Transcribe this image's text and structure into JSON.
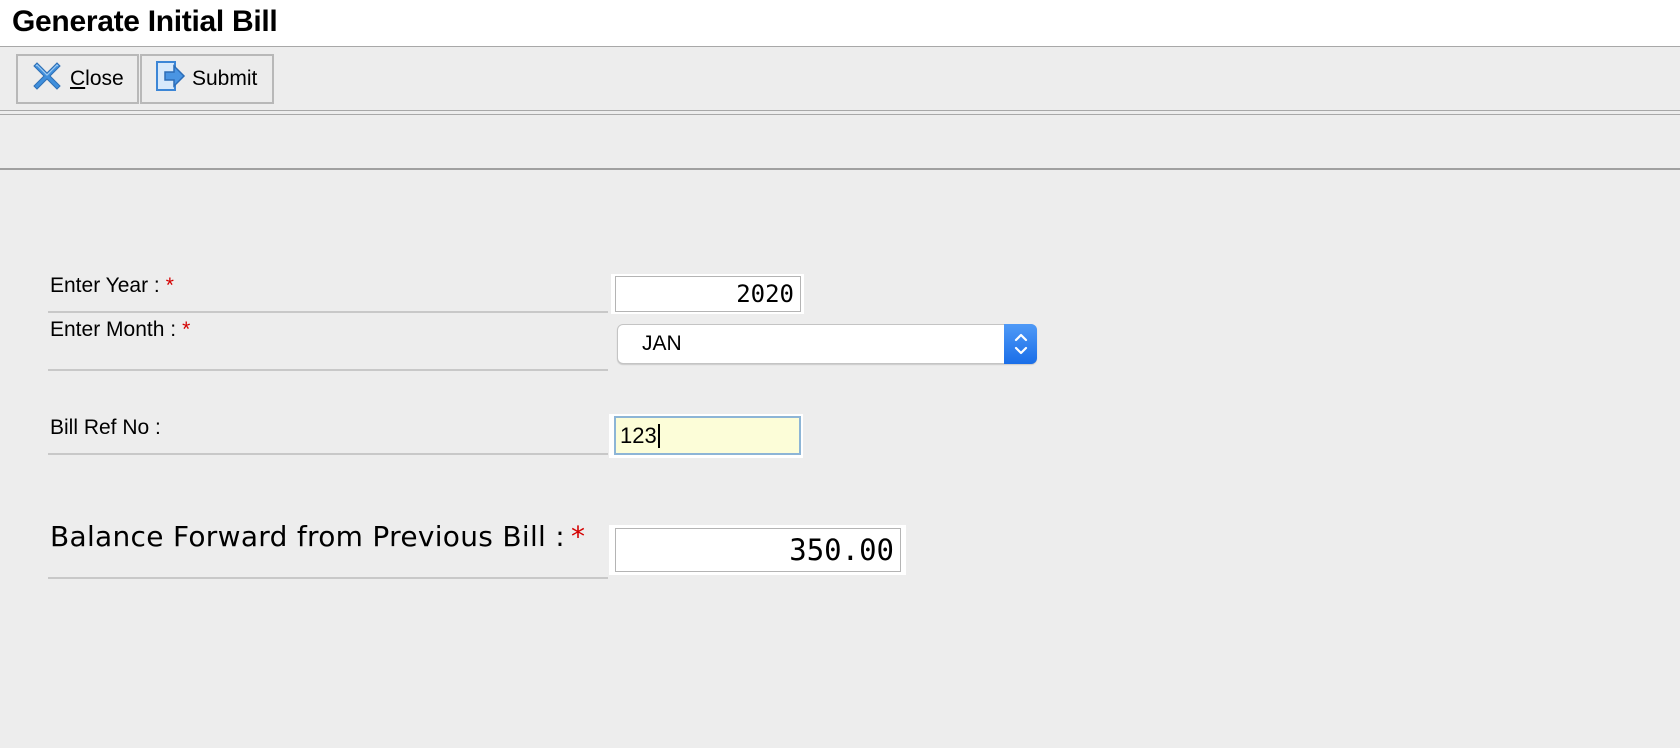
{
  "window": {
    "title": "Generate Initial Bill"
  },
  "toolbar": {
    "close_mnemonic": "C",
    "close_rest": "lose",
    "submit_label": "Submit",
    "close_icon": "close-x-icon",
    "submit_icon": "submit-arrow-icon"
  },
  "form": {
    "year": {
      "label": "Enter Year :",
      "required_mark": "*",
      "value": "2020"
    },
    "month": {
      "label": "Enter Month :",
      "required_mark": "*",
      "selected": "JAN"
    },
    "bill_ref": {
      "label": "Bill Ref No :",
      "value": "123"
    },
    "balance_forward": {
      "label": "Balance Forward from Previous Bill :",
      "required_mark": "*",
      "value": "350.00"
    }
  },
  "colors": {
    "required": "#d40000",
    "focused_field_bg": "#fcfdd8",
    "focused_field_border": "#8db5d6",
    "select_arrow_bg": "#2a7cf0"
  }
}
